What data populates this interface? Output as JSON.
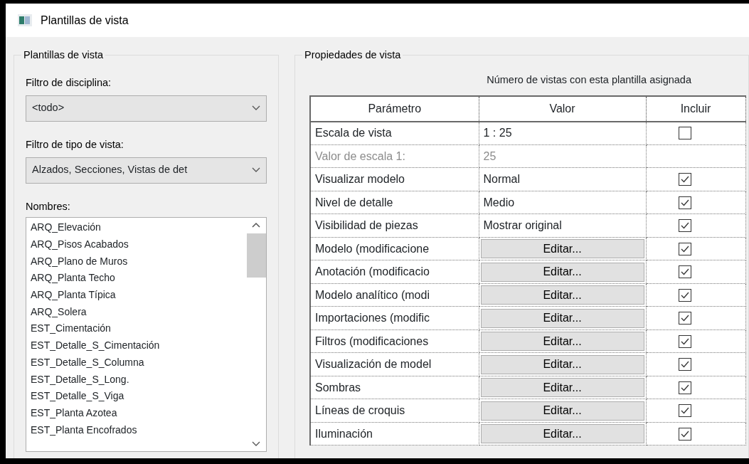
{
  "window": {
    "title": "Plantillas de vista"
  },
  "templates_group": {
    "title": "Plantillas de vista",
    "discipline_label": "Filtro de disciplina:",
    "discipline_value": "<todo>",
    "view_type_label": "Filtro de tipo de vista:",
    "view_type_value": "Alzados, Secciones, Vistas de det",
    "names_label": "Nombres:",
    "names": [
      {
        "text": "ARQ_Elevación",
        "selected": false
      },
      {
        "text": "ARQ_Pisos Acabados",
        "selected": false
      },
      {
        "text": "ARQ_Plano de Muros",
        "selected": false
      },
      {
        "text": "ARQ_Planta Techo",
        "selected": false
      },
      {
        "text": "ARQ_Planta Típica",
        "selected": false
      },
      {
        "text": "ARQ_Solera",
        "selected": false
      },
      {
        "text": "EST_Cimentación",
        "selected": false
      },
      {
        "text": "EST_Detalle_S_Cimentación",
        "selected": false
      },
      {
        "text": "EST_Detalle_S_Columna",
        "selected": false
      },
      {
        "text": "EST_Detalle_S_Long.",
        "selected": false
      },
      {
        "text": "EST_Detalle_S_Viga",
        "selected": false
      },
      {
        "text": "EST_Planta Azotea",
        "selected": false
      },
      {
        "text": "EST_Planta Encofrados",
        "selected": false
      }
    ]
  },
  "properties_group": {
    "title": "Propiedades de vista",
    "count_label": "Número de vistas con esta plantilla asignada",
    "table": {
      "columns": [
        "Parámetro",
        "Valor",
        "Incluir"
      ],
      "rows": [
        {
          "kind": "value",
          "parameter": "Escala de vista",
          "value": "1 : 25",
          "include": false
        },
        {
          "kind": "disabled",
          "parameter": "Valor de escala    1:",
          "value": "25"
        },
        {
          "kind": "value",
          "parameter": "Visualizar modelo",
          "value": "Normal",
          "include": true
        },
        {
          "kind": "value",
          "parameter": "Nivel de detalle",
          "value": "Medio",
          "include": true
        },
        {
          "kind": "value",
          "parameter": "Visibilidad de piezas",
          "value": "Mostrar original",
          "include": true
        },
        {
          "kind": "button",
          "parameter": "Modelo (modificacione",
          "value": "Editar...",
          "include": true
        },
        {
          "kind": "button",
          "parameter": "Anotación (modificacio",
          "value": "Editar...",
          "include": true
        },
        {
          "kind": "button",
          "parameter": "Modelo analítico (modi",
          "value": "Editar...",
          "include": true
        },
        {
          "kind": "button",
          "parameter": "Importaciones (modific",
          "value": "Editar...",
          "include": true
        },
        {
          "kind": "button",
          "parameter": "Filtros (modificaciones",
          "value": "Editar...",
          "include": true
        },
        {
          "kind": "button",
          "parameter": "Visualización de model",
          "value": "Editar...",
          "include": true
        },
        {
          "kind": "button",
          "parameter": "Sombras",
          "value": "Editar...",
          "include": true
        },
        {
          "kind": "button",
          "parameter": "Líneas de croquis",
          "value": "Editar...",
          "include": true
        },
        {
          "kind": "button",
          "parameter": "Iluminación",
          "value": "Editar...",
          "include": true
        }
      ]
    }
  }
}
